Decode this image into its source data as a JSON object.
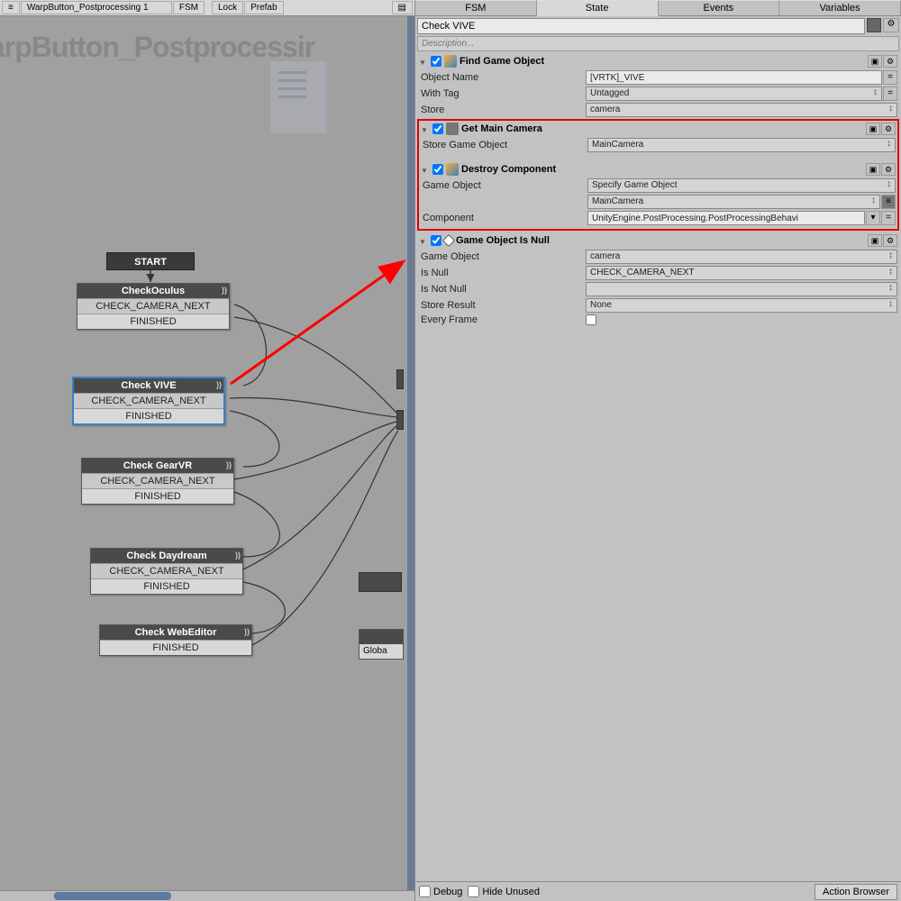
{
  "left": {
    "toolbar": {
      "dropdown": "WarpButton_Postprocessing 1",
      "fsm": "FSM",
      "lock": "Lock",
      "prefab": "Prefab"
    },
    "canvas_title": "arpButton_Postprocessir",
    "start": "START",
    "nodes": [
      {
        "title": "CheckOculus",
        "rows": [
          "CHECK_CAMERA_NEXT",
          "FINISHED"
        ]
      },
      {
        "title": "Check VIVE",
        "rows": [
          "CHECK_CAMERA_NEXT",
          "FINISHED"
        ]
      },
      {
        "title": "Check GearVR",
        "rows": [
          "CHECK_CAMERA_NEXT",
          "FINISHED"
        ]
      },
      {
        "title": "Check Daydream",
        "rows": [
          "CHECK_CAMERA_NEXT",
          "FINISHED"
        ]
      },
      {
        "title": "Check WebEditor",
        "rows": [
          "FINISHED"
        ]
      }
    ],
    "global_text": "Globa"
  },
  "tabs": [
    "FSM",
    "State",
    "Events",
    "Variables"
  ],
  "state_name": "Check VIVE",
  "description_placeholder": "Description...",
  "actions": {
    "findGameObject": {
      "title": "Find Game Object",
      "objectName": {
        "label": "Object Name",
        "value": "[VRTK]_VIVE"
      },
      "withTag": {
        "label": "With Tag",
        "value": "Untagged"
      },
      "store": {
        "label": "Store",
        "value": "camera"
      }
    },
    "getMainCamera": {
      "title": "Get Main Camera",
      "storeGameObject": {
        "label": "Store Game Object",
        "value": "MainCamera"
      }
    },
    "destroyComponent": {
      "title": "Destroy Component",
      "gameObject": {
        "label": "Game Object",
        "value": "Specify Game Object"
      },
      "gameObjectField": "MainCamera",
      "component": {
        "label": "Component",
        "value": "UnityEngine.PostProcessing.PostProcessingBehavi"
      }
    },
    "gameObjectIsNull": {
      "title": "Game Object Is Null",
      "gameObject": {
        "label": "Game Object",
        "value": "camera"
      },
      "isNull": {
        "label": "Is Null",
        "value": "CHECK_CAMERA_NEXT"
      },
      "isNotNull": {
        "label": "Is Not Null",
        "value": ""
      },
      "storeResult": {
        "label": "Store Result",
        "value": "None"
      },
      "everyFrame": {
        "label": "Every Frame"
      }
    }
  },
  "bottom": {
    "debug": "Debug",
    "hideUnused": "Hide Unused",
    "actionBrowser": "Action Browser"
  }
}
